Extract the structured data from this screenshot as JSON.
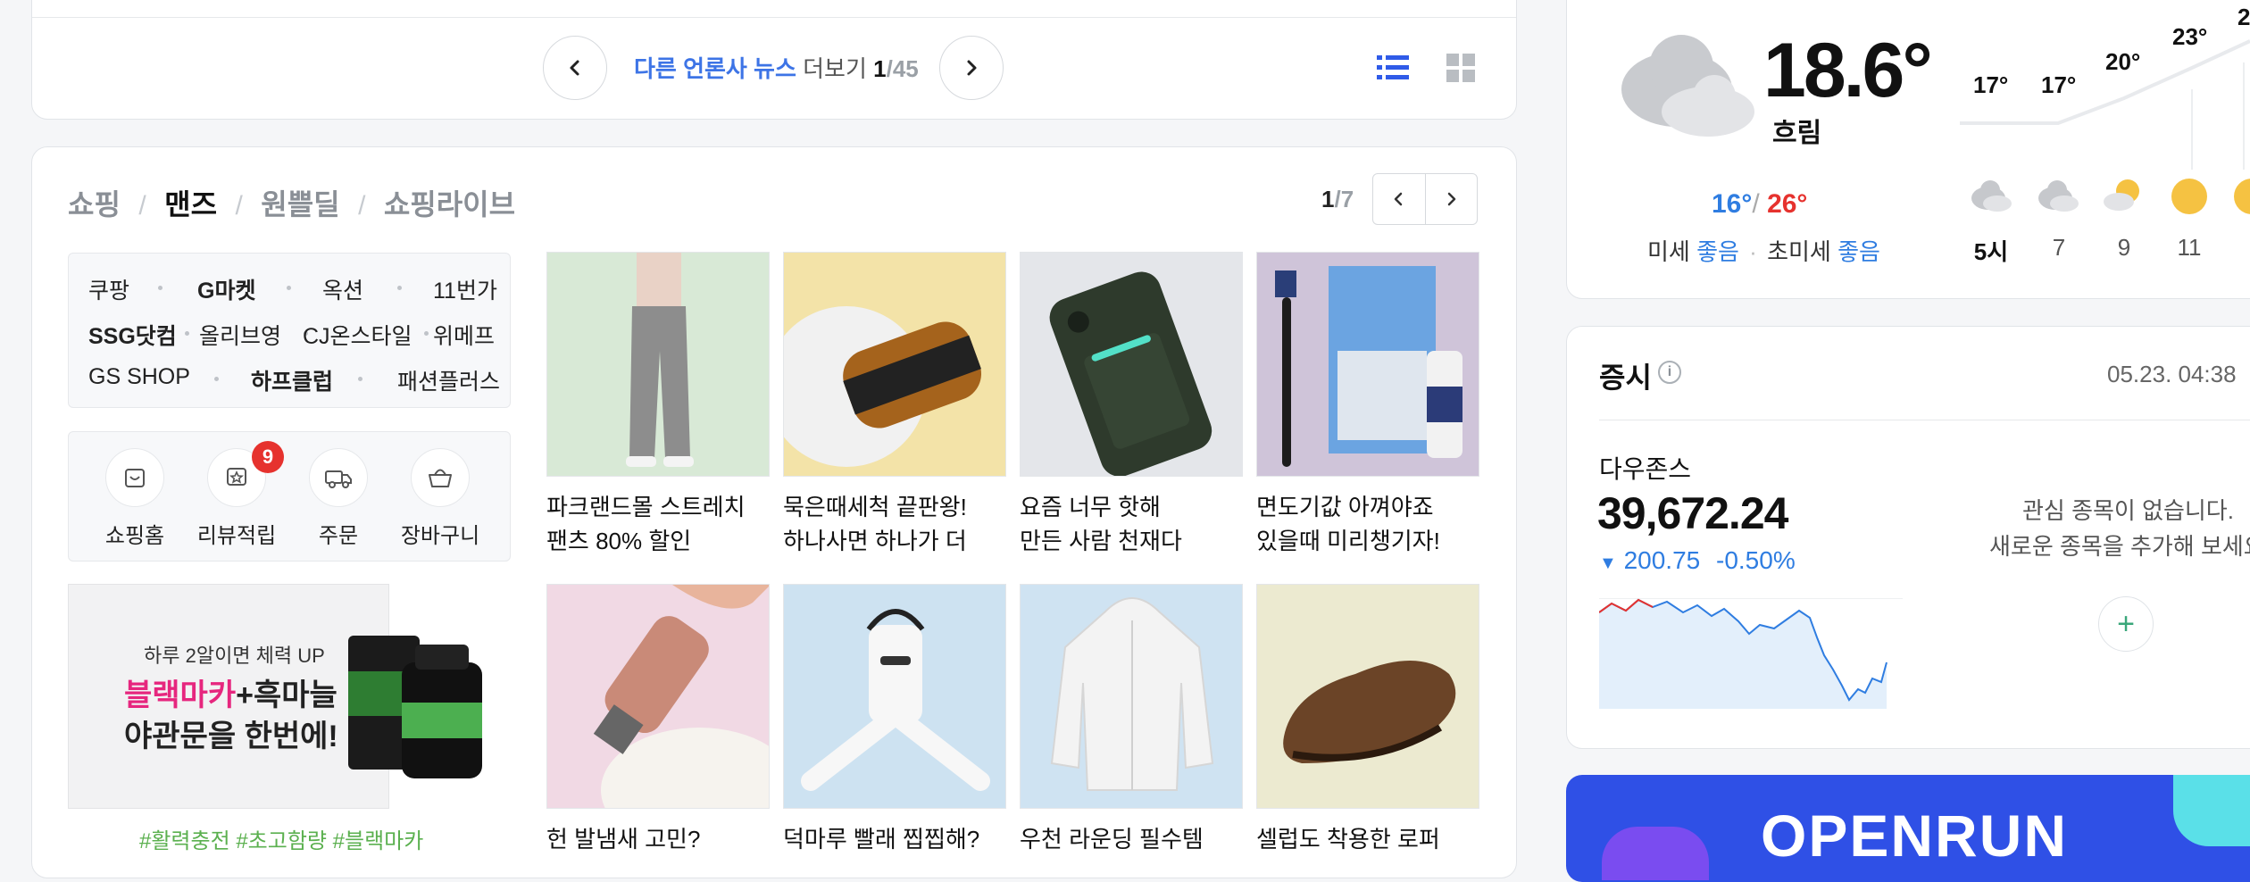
{
  "news_pager": {
    "more_link": "다른 언론사 뉴스",
    "more_suffix": "더보기",
    "current": "1",
    "total": "/45"
  },
  "shopping": {
    "tabs": [
      "쇼핑",
      "맨즈",
      "원쁠딜",
      "쇼핑라이브"
    ],
    "active_tab": 1,
    "page_current": "1",
    "page_total": "/7",
    "malls": [
      [
        {
          "name": "쿠팡",
          "bold": false
        },
        {
          "name": "G마켓",
          "bold": true
        },
        {
          "name": "옥션",
          "bold": false
        },
        {
          "name": "11번가",
          "bold": false
        }
      ],
      [
        {
          "name": "SSG닷컴",
          "bold": true
        },
        {
          "name": "올리브영",
          "bold": false
        },
        {
          "name": "CJ온스타일",
          "bold": false
        },
        {
          "name": "위메프",
          "bold": false
        }
      ],
      [
        {
          "name": "GS SHOP",
          "bold": false
        },
        {
          "name": "하프클럽",
          "bold": true
        },
        {
          "name": "패션플러스",
          "bold": false
        }
      ]
    ],
    "quick": [
      {
        "label": "쇼핑홈",
        "icon": "shopping-bag-home-icon"
      },
      {
        "label": "리뷰적립",
        "icon": "review-star-icon",
        "badge": "9"
      },
      {
        "label": "주문",
        "icon": "truck-icon"
      },
      {
        "label": "장바구니",
        "icon": "basket-icon"
      }
    ],
    "ad": {
      "line1": "하루 2알이면 체력 UP",
      "line2_pink": "블랙마카",
      "line2_rest": "+흑마늘",
      "line3": "야관문을 한번에!",
      "hashtags": "#활력충전 #초고함량 #블랙마카"
    },
    "products": [
      {
        "line1": "파크랜드몰 스트레치",
        "line2": "팬츠 80% 할인"
      },
      {
        "line1": "묵은때세척 끝판왕!",
        "line2": "하나사면 하나가 더"
      },
      {
        "line1": "요즘 너무 핫해",
        "line2": "만든 사람 천재다"
      },
      {
        "line1": "면도기값 아껴야죠",
        "line2": "있을때 미리챙기자!"
      },
      {
        "line1": "헌 발냄새 고민?",
        "line2": ""
      },
      {
        "line1": "덕마루 빨래 찝찝해?",
        "line2": ""
      },
      {
        "line1": "우천 라운딩 필수템",
        "line2": ""
      },
      {
        "line1": "셀럽도 착용한 로퍼",
        "line2": ""
      }
    ],
    "product_colors": [
      "#d8e9d6",
      "#f3e3a8",
      "#e4e6ea",
      "#cfc4d9",
      "#f1d9e4",
      "#cde2f1",
      "#cfe3f2",
      "#ecead0"
    ]
  },
  "weather": {
    "temp": "18.6°",
    "condition": "흐림",
    "low": "16°",
    "slash": "/",
    "high": "26°",
    "fine_dust_label": "미세",
    "fine_dust_value": "좋음",
    "ultra_dust_label": "초미세",
    "ultra_dust_value": "좋음",
    "hourly_temps": [
      "17°",
      "17°",
      "20°",
      "23°",
      "2"
    ],
    "hours": [
      "5시",
      "7",
      "9",
      "11",
      ""
    ],
    "hourly_icons": [
      "cloud-icon",
      "cloud-icon",
      "partly-sunny-icon",
      "sun-icon",
      "sun-icon"
    ]
  },
  "stocks": {
    "title": "증시",
    "timestamp": "05.23. 04:38",
    "index_name": "다우존스",
    "index_value": "39,672.24",
    "change": "200.75",
    "change_pct": "-0.50%",
    "empty_line1": "관심 종목이 없습니다.",
    "empty_line2": "새로운 종목을 추가해 보세요",
    "add_symbol": "+"
  },
  "banner": {
    "text": "OPENRUN"
  },
  "colors": {
    "accent_blue": "#2f5be8",
    "link_blue": "#3d74e6",
    "red": "#e6322e",
    "pink": "#e6267e",
    "hashtag_green": "#5bb04f",
    "stock_blue": "#2f7de1"
  }
}
